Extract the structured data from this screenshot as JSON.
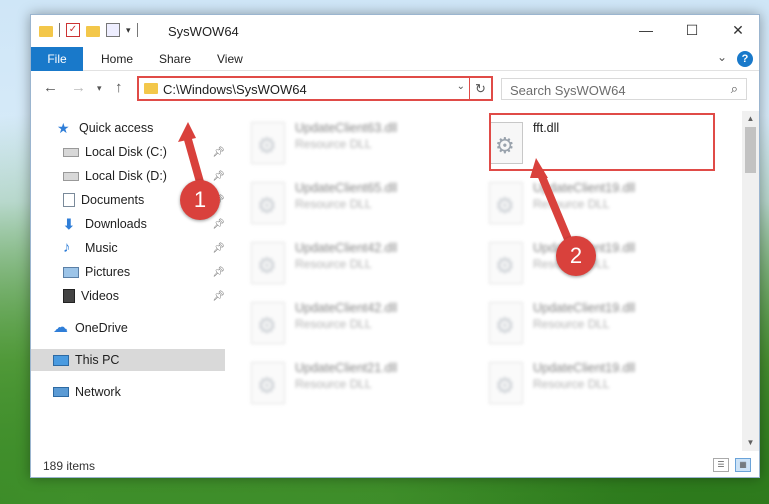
{
  "window": {
    "title": "SysWOW64",
    "controls": {
      "minimize": "—",
      "maximize": "☐",
      "close": "✕"
    }
  },
  "ribbon": {
    "tabs": [
      "File",
      "Home",
      "Share",
      "View"
    ],
    "help": "?"
  },
  "nav": {
    "address": "C:\\Windows\\SysWOW64",
    "search_placeholder": "Search SysWOW64"
  },
  "sidebar": {
    "items": [
      {
        "label": "Quick access",
        "icon": "star-icon",
        "color": "#2f7ed8"
      },
      {
        "label": "Local Disk (C:)",
        "icon": "drive-icon",
        "pinned": true
      },
      {
        "label": "Local Disk (D:)",
        "icon": "drive-icon",
        "pinned": true
      },
      {
        "label": "Documents",
        "icon": "document-icon",
        "pinned": true
      },
      {
        "label": "Downloads",
        "icon": "download-icon",
        "pinned": true
      },
      {
        "label": "Music",
        "icon": "music-icon",
        "pinned": true
      },
      {
        "label": "Pictures",
        "icon": "pictures-icon",
        "pinned": true
      },
      {
        "label": "Videos",
        "icon": "videos-icon",
        "pinned": true
      },
      {
        "label": "OneDrive",
        "icon": "cloud-icon"
      },
      {
        "label": "This PC",
        "icon": "computer-icon",
        "selected": true
      },
      {
        "label": "Network",
        "icon": "network-icon"
      }
    ]
  },
  "files": [
    {
      "name": "UpdateClient63.dll",
      "type": "Resource DLL"
    },
    {
      "name": "fft.dll",
      "type": ""
    },
    {
      "name": "UpdateClient65.dll",
      "type": "Resource DLL"
    },
    {
      "name": "UpdateClient19.dll",
      "type": "Resource DLL"
    },
    {
      "name": "UpdateClient42.dll",
      "type": "Resource DLL"
    },
    {
      "name": "UpdateClient19.dll",
      "type": "Resource DLL"
    },
    {
      "name": "UpdateClient42.dll",
      "type": "Resource DLL"
    },
    {
      "name": "UpdateClient19.dll",
      "type": "Resource DLL"
    },
    {
      "name": "UpdateClient21.dll",
      "type": "Resource DLL"
    },
    {
      "name": "UpdateClient19.dll",
      "type": "Resource DLL"
    }
  ],
  "status": {
    "count": "189 items"
  },
  "annotations": {
    "step1": "1",
    "step2": "2",
    "color": "#d9413c"
  }
}
